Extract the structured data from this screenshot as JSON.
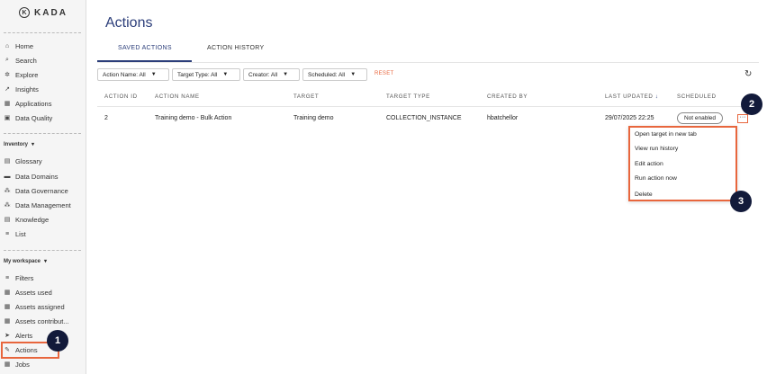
{
  "brand": {
    "logo_mark": "K",
    "name": "KADA"
  },
  "sidebar": {
    "top_items": [
      {
        "label": "Home",
        "icon": "home-icon",
        "glyph": "⌂"
      },
      {
        "label": "Search",
        "icon": "search-icon",
        "glyph": "⌕"
      },
      {
        "label": "Explore",
        "icon": "explore-icon",
        "glyph": "✲"
      },
      {
        "label": "Insights",
        "icon": "trend-icon",
        "glyph": "↗"
      },
      {
        "label": "Applications",
        "icon": "grid-icon",
        "glyph": "▦"
      },
      {
        "label": "Data Quality",
        "icon": "quality-icon",
        "glyph": "▣"
      }
    ],
    "inventory_label": "Inventory",
    "inventory_items": [
      {
        "label": "Glossary",
        "icon": "book-icon",
        "glyph": "▤"
      },
      {
        "label": "Data Domains",
        "icon": "folder-icon",
        "glyph": "▬"
      },
      {
        "label": "Data Governance",
        "icon": "hierarchy-icon",
        "glyph": "⁂"
      },
      {
        "label": "Data Management",
        "icon": "hierarchy-icon",
        "glyph": "⁂"
      },
      {
        "label": "Knowledge",
        "icon": "document-icon",
        "glyph": "▤"
      },
      {
        "label": "List",
        "icon": "list-icon",
        "glyph": "≡"
      }
    ],
    "workspace_label": "My workspace",
    "workspace_items": [
      {
        "label": "Filters",
        "icon": "filter-icon",
        "glyph": "≡"
      },
      {
        "label": "Assets used",
        "icon": "table-icon",
        "glyph": "▦"
      },
      {
        "label": "Assets assigned",
        "icon": "table-icon",
        "glyph": "▦"
      },
      {
        "label": "Assets contribut...",
        "icon": "table-icon",
        "glyph": "▦"
      },
      {
        "label": "Alerts",
        "icon": "send-icon",
        "glyph": "➤"
      },
      {
        "label": "Actions",
        "icon": "pencil-icon",
        "glyph": "✎"
      },
      {
        "label": "Jobs",
        "icon": "grid-icon",
        "glyph": "▦"
      }
    ]
  },
  "page": {
    "title": "Actions"
  },
  "tabs": [
    {
      "label": "SAVED ACTIONS"
    },
    {
      "label": "ACTION HISTORY"
    }
  ],
  "filters": [
    {
      "label": "Action Name: All"
    },
    {
      "label": "Target Type: All"
    },
    {
      "label": "Creator: All"
    },
    {
      "label": "Scheduled: All"
    }
  ],
  "reset_label": "RESET",
  "table": {
    "headers": [
      "ACTION ID",
      "ACTION NAME",
      "TARGET",
      "TARGET TYPE",
      "CREATED BY",
      "LAST UPDATED",
      "SCHEDULED"
    ],
    "sort_indicator": "↓",
    "rows": [
      {
        "id": "2",
        "name": "Training demo - Bulk Action",
        "target": "Training demo",
        "target_type": "COLLECTION_INSTANCE",
        "created_by": "hbatchellor",
        "last_updated": "29/07/2025 22:25",
        "scheduled": "Not enabled"
      }
    ]
  },
  "more_label": "···",
  "menu": [
    {
      "label": "Open target in new tab"
    },
    {
      "label": "View run history"
    },
    {
      "label": "Edit action"
    },
    {
      "label": "Run action now"
    },
    {
      "label": "Delete"
    }
  ],
  "badges": [
    "1",
    "2",
    "3"
  ],
  "colors": {
    "accent": "#2c3e7a",
    "highlight": "#e8663d",
    "badge": "#121a3a"
  }
}
